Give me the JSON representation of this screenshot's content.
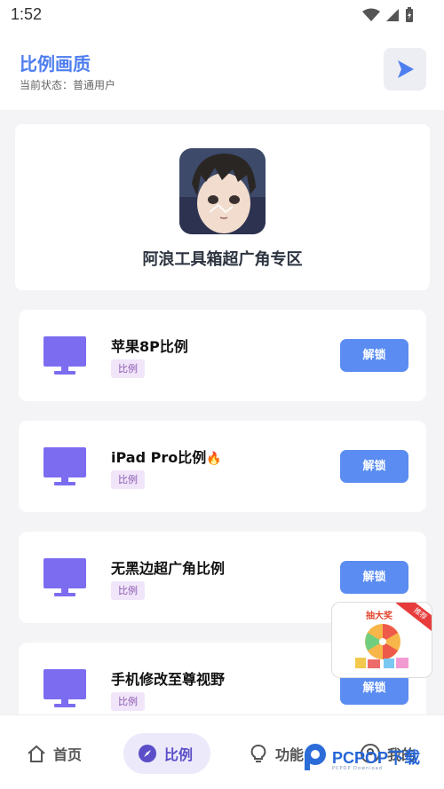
{
  "status_bar": {
    "time": "1:52"
  },
  "header": {
    "title": "比例画质",
    "subtitle": "当前状态：普通用户"
  },
  "feature": {
    "title": "阿浪工具箱超广角专区"
  },
  "items": [
    {
      "title": "苹果8P比例",
      "tag": "比例",
      "button": "解锁"
    },
    {
      "title": "iPad Pro比例",
      "tag": "比例",
      "button": "解锁",
      "emoji": "🔥"
    },
    {
      "title": "无黑边超广角比例",
      "tag": "比例",
      "button": "解锁"
    },
    {
      "title": "手机修改至尊视野",
      "tag": "比例",
      "button": "解锁"
    }
  ],
  "promo": {
    "title": "抽大奖",
    "ribbon": "推荐"
  },
  "bottom_nav": [
    {
      "label": "首页",
      "icon": "home-icon"
    },
    {
      "label": "比例",
      "icon": "compass-icon",
      "active": true
    },
    {
      "label": "功能",
      "icon": "lightbulb-icon"
    },
    {
      "label": "我的",
      "icon": "user-icon"
    }
  ],
  "watermark": {
    "text": "PCPOP下载",
    "sub": "PCPOP Download"
  },
  "colors": {
    "accent": "#4f7ef0",
    "button": "#5a8cf2",
    "monitor": "#7b6cf0",
    "nav_active": "#5b4ec8"
  }
}
